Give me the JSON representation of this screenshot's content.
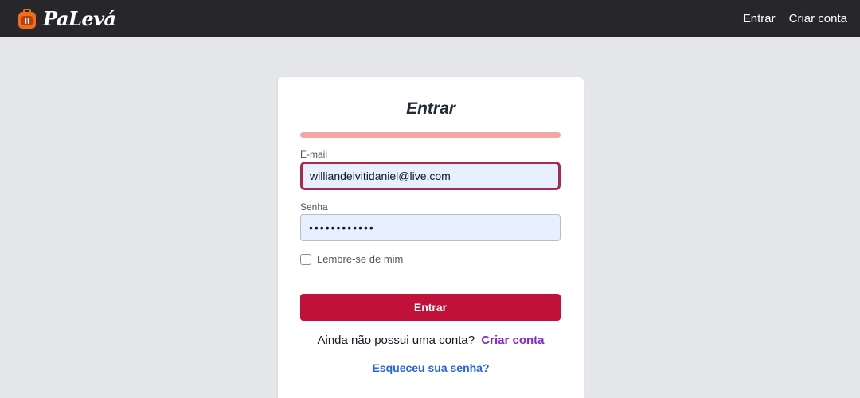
{
  "nav": {
    "brand": "PaLevá",
    "links": [
      "Entrar",
      "Criar conta"
    ]
  },
  "form": {
    "title": "Entrar",
    "progress_fraction": 1.0,
    "email_label": "E-mail",
    "email_value": "williandeivitidaniel@live.com",
    "password_label": "Senha",
    "password_masked": "••••••••••••",
    "remember_label": "Lembre-se de mim",
    "remember_checked": false,
    "submit_label": "Entrar",
    "signup_prompt": "Ainda não possui uma conta?",
    "signup_link": "Criar conta",
    "forgot_link": "Esqueceu sua senha?"
  },
  "colors": {
    "navbar": "#27262b",
    "page_bg": "#e5e6ea",
    "primary": "#c01138",
    "progress": "#f3a6a6",
    "focus_border": "#a72a55",
    "signup_link": "#7e2ad6",
    "forgot_link": "#2563eb"
  },
  "icons": {
    "brand": "backpack-icon"
  }
}
